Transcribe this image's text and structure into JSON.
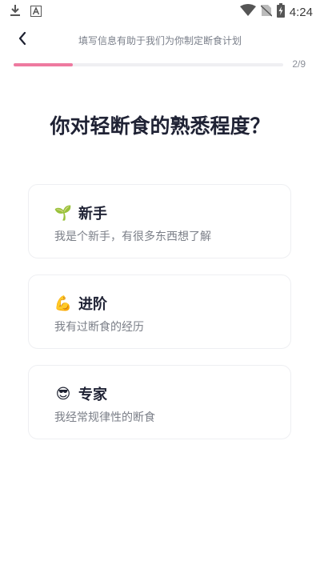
{
  "status_bar": {
    "time": "4:24",
    "icons": [
      "download-icon",
      "font-a-icon",
      "wifi-icon",
      "no-sim-icon",
      "battery-charging-icon"
    ]
  },
  "header": {
    "back_icon": "chevron-left-icon",
    "title": "填写信息有助于我们为你制定断食计划"
  },
  "progress": {
    "current": 2,
    "total": 9,
    "label": "2/9",
    "fill_fraction": 0.22,
    "color": "#ee7aa0"
  },
  "question": "你对轻断食的熟悉程度？",
  "options": [
    {
      "emoji": "🌱",
      "emoji_name": "seedling-icon",
      "title": "新手",
      "desc": "我是个新手，有很多东西想了解"
    },
    {
      "emoji": "💪",
      "emoji_name": "flexed-arm-icon",
      "title": "进阶",
      "desc": "我有过断食的经历"
    },
    {
      "emoji": "😎",
      "emoji_name": "sunglasses-face-icon",
      "title": "专家",
      "desc": "我经常规律性的断食"
    }
  ]
}
